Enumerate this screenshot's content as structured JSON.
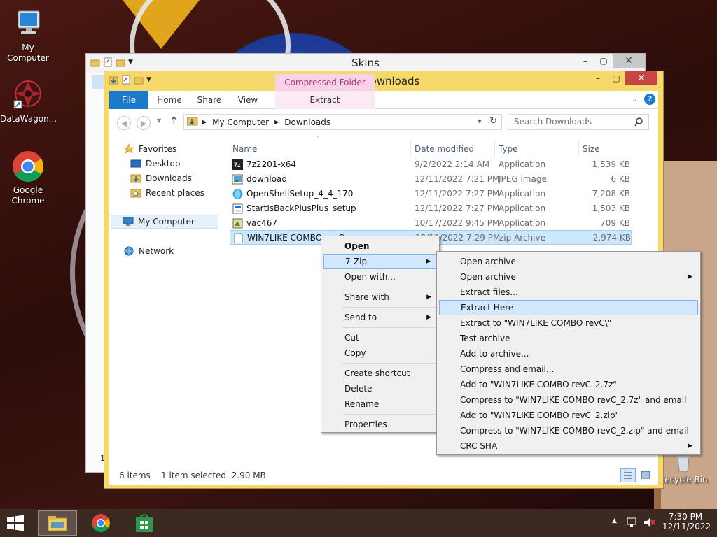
{
  "desktop": {
    "icons": [
      {
        "label": "My Computer"
      },
      {
        "label": "DataWagon..."
      },
      {
        "label": "Google Chrome"
      },
      {
        "label": "Recycle Bin"
      }
    ]
  },
  "skins_window": {
    "title": "Skins",
    "partial_char": "1"
  },
  "explorer": {
    "title": "Downloads",
    "tabs": {
      "file": "File",
      "home": "Home",
      "share": "Share",
      "view": "View"
    },
    "context_tab_header": "Compressed Folder Tools",
    "context_tab": "Extract",
    "address": {
      "crumbs": [
        "My Computer",
        "Downloads"
      ]
    },
    "search": {
      "placeholder": "Search Downloads"
    },
    "nav": {
      "favorites": "Favorites",
      "desktop": "Desktop",
      "downloads": "Downloads",
      "recent": "Recent places",
      "my_computer": "My Computer",
      "network": "Network"
    },
    "columns": {
      "name": "Name",
      "date": "Date modified",
      "type": "Type",
      "size": "Size"
    },
    "files": [
      {
        "name": "7z2201-x64",
        "date": "9/2/2022 2:14 AM",
        "type": "Application",
        "size": "1,539 KB",
        "icon": "7zip-installer-icon"
      },
      {
        "name": "download",
        "date": "12/11/2022 7:21 PM",
        "type": "JPEG image",
        "size": "6 KB",
        "icon": "image-file-icon"
      },
      {
        "name": "OpenShellSetup_4_4_170",
        "date": "12/11/2022 7:27 PM",
        "type": "Application",
        "size": "7,208 KB",
        "icon": "openshell-icon"
      },
      {
        "name": "StartIsBackPlusPlus_setup",
        "date": "12/11/2022 7:27 PM",
        "type": "Application",
        "size": "1,503 KB",
        "icon": "installer-icon"
      },
      {
        "name": "vac467",
        "date": "10/17/2022 9:45 PM",
        "type": "Application",
        "size": "709 KB",
        "icon": "setup-icon"
      },
      {
        "name": "WIN7LIKE COMBO revC",
        "date": "12/11/2022 7:29 PM",
        "type": "zip Archive",
        "size": "2,974 KB",
        "icon": "zip-file-icon"
      }
    ],
    "status": {
      "items": "6 items",
      "selected": "1 item selected  2.90 MB"
    }
  },
  "context_menu": {
    "items": [
      {
        "label": "Open",
        "bold": true
      },
      {
        "label": "7-Zip",
        "submenu": true
      },
      {
        "label": "Open with..."
      },
      {
        "label": "Share with",
        "submenu": true
      },
      {
        "label": "Send to",
        "submenu": true
      },
      {
        "label": "Cut"
      },
      {
        "label": "Copy"
      },
      {
        "label": "Create shortcut"
      },
      {
        "label": "Delete"
      },
      {
        "label": "Rename"
      },
      {
        "label": "Properties"
      }
    ]
  },
  "zip_menu": {
    "items": [
      {
        "label": "Open archive"
      },
      {
        "label": "Open archive",
        "submenu": true
      },
      {
        "label": "Extract files..."
      },
      {
        "label": "Extract Here"
      },
      {
        "label": "Extract to \"WIN7LIKE COMBO revC\\\""
      },
      {
        "label": "Test archive"
      },
      {
        "label": "Add to archive..."
      },
      {
        "label": "Compress and email..."
      },
      {
        "label": "Add to \"WIN7LIKE COMBO revC_2.7z\""
      },
      {
        "label": "Compress to \"WIN7LIKE COMBO revC_2.7z\" and email"
      },
      {
        "label": "Add to \"WIN7LIKE COMBO revC_2.zip\""
      },
      {
        "label": "Compress to \"WIN7LIKE COMBO revC_2.zip\" and email"
      },
      {
        "label": "CRC SHA",
        "submenu": true
      }
    ]
  },
  "taskbar": {
    "time": "7:30 PM",
    "date": "12/11/2022",
    "apps": [
      "file-explorer",
      "google-chrome",
      "windows-store"
    ]
  },
  "colors": {
    "window_frame": "#f5d96a",
    "file_tab": "#1979ca",
    "selection": "#cce8ff",
    "menu_highlight": "#d1e8ff",
    "close_button": "#c74545"
  }
}
